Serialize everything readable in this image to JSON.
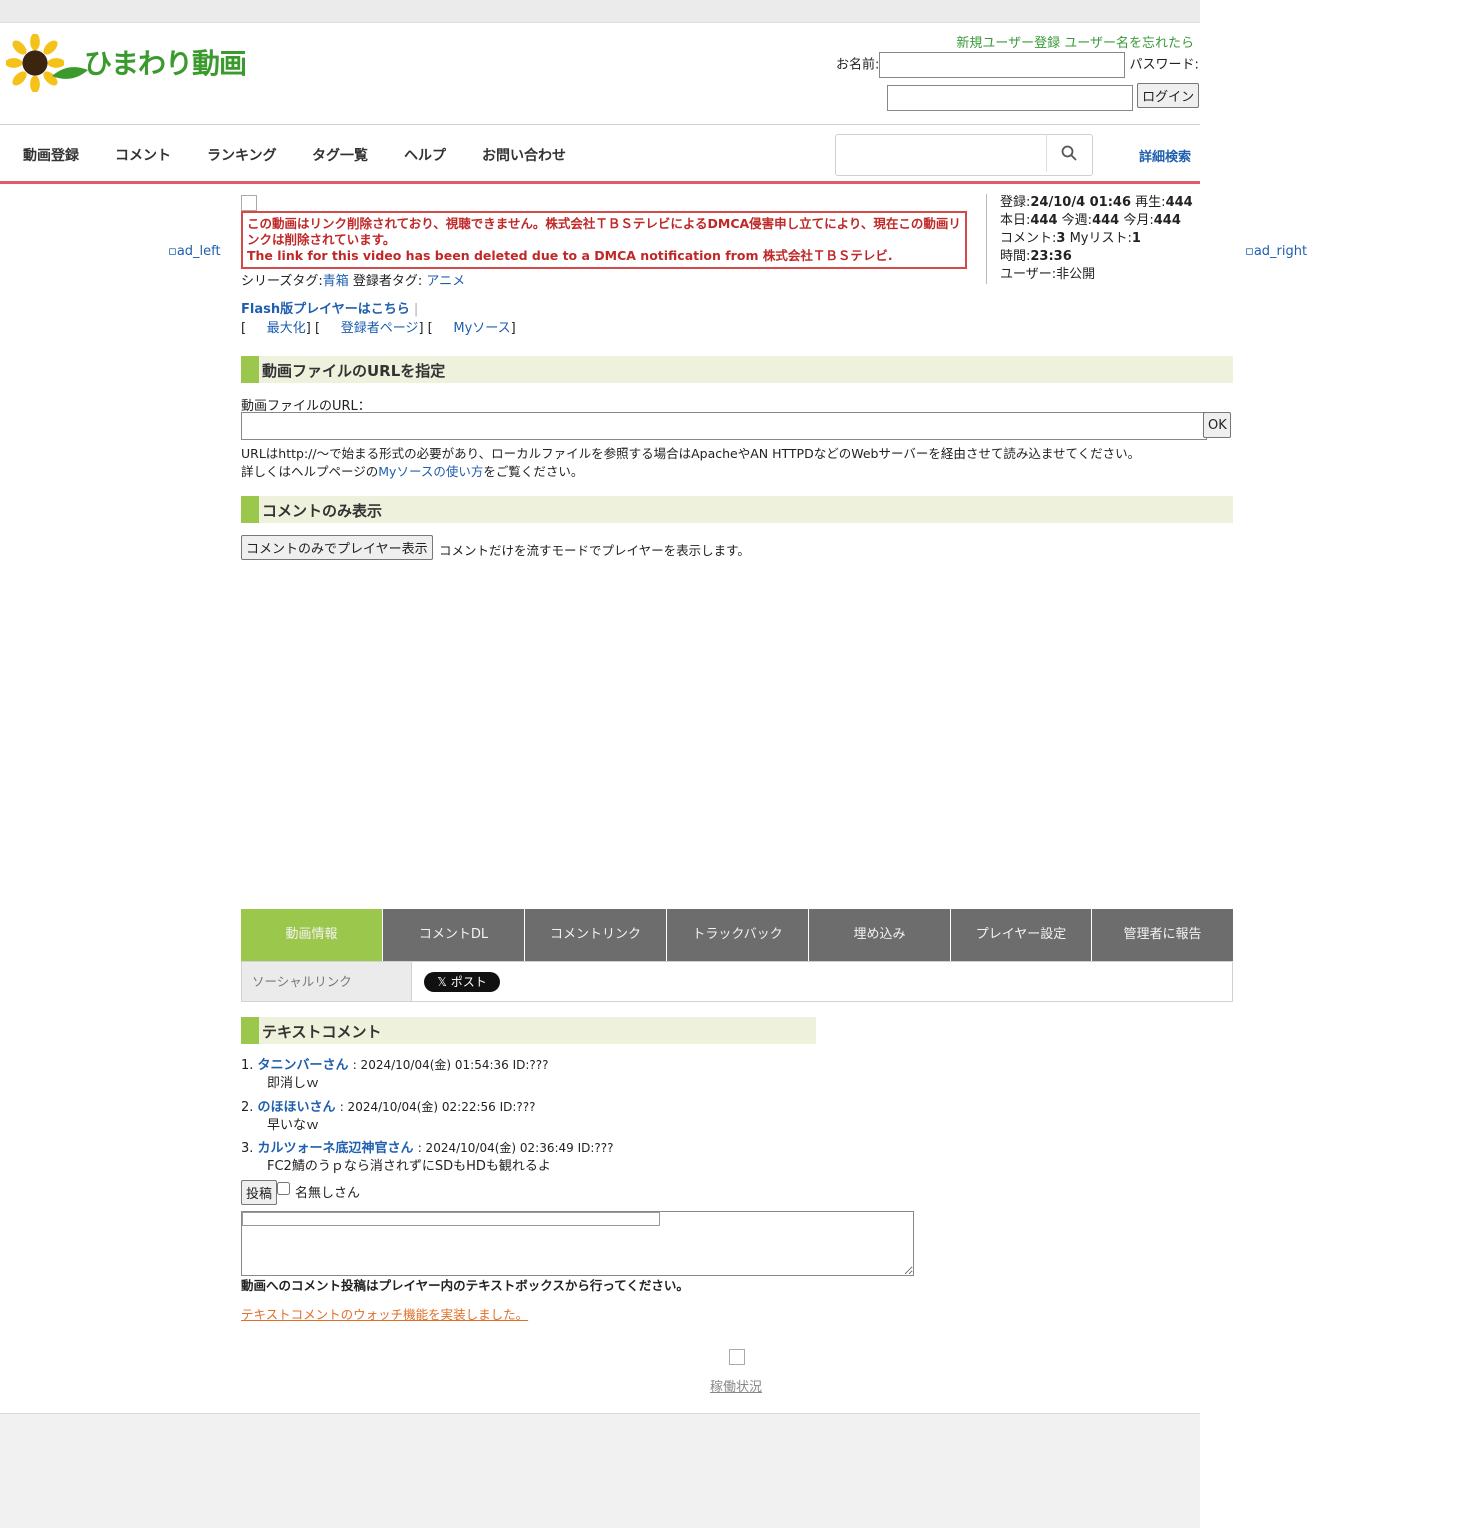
{
  "header": {
    "site_name": "ひまわり動画",
    "register_link": "新規ユーザー登録",
    "forgot_link": "ユーザー名を忘れたら",
    "name_label": "お名前:",
    "password_label": "パスワード:",
    "login_button": "ログイン"
  },
  "nav": {
    "items": [
      "動画登録",
      "コメント",
      "ランキング",
      "タグ一覧",
      "ヘルプ",
      "お問い合わせ"
    ],
    "detail_search": "詳細検索"
  },
  "ads": {
    "left": "ad_left",
    "right": "ad_right"
  },
  "notice": {
    "jp": "この動画はリンク削除されており、視聴できません。株式会社ＴＢＳテレビによるDMCA侵害申し立てにより、現在この動画リンクは削除されています。",
    "en": "The link for this video has been deleted due to a DMCA notification from 株式会社ＴＢＳテレビ."
  },
  "tags": {
    "series_label": "シリーズタグ:",
    "series_value": "青箱",
    "user_label": "登録者タグ:",
    "user_value": "アニメ"
  },
  "links": {
    "flash": "Flash版プレイヤーはこちら",
    "maximize": "最大化",
    "uploader": "登録者ページ",
    "mysource": "Myソース"
  },
  "stats": {
    "registered_label": "登録:",
    "registered": "24/10/4 01:46",
    "plays_label": "再生:",
    "plays": "444",
    "today_label": "本日:",
    "today": "444",
    "week_label": "今週:",
    "week": "444",
    "month_label": "今月:",
    "month": "444",
    "comments_label": "コメント:",
    "comments": "3",
    "mylist_label": "Myリスト:",
    "mylist": "1",
    "duration_label": "時間:",
    "duration": "23:36",
    "user_label": "ユーザー:",
    "user": "非公開"
  },
  "url_section": {
    "heading": "動画ファイルのURLを指定",
    "label": "動画ファイルのURL：",
    "ok": "OK",
    "note1": "URLはhttp://〜で始まる形式の必要があり、ローカルファイルを参照する場合はApacheやAN HTTPDなどのWebサーバーを経由させて読み込ませてください。",
    "note2_pre": "詳しくはヘルプページの",
    "note2_link": "Myソースの使い方",
    "note2_post": "をご覧ください。"
  },
  "comment_only": {
    "heading": "コメントのみ表示",
    "button": "コメントのみでプレイヤー表示",
    "desc": "コメントだけを流すモードでプレイヤーを表示します。"
  },
  "tabs": [
    "動画情報",
    "コメントDL",
    "コメントリンク",
    "トラックバック",
    "埋め込み",
    "プレイヤー設定",
    "管理者に報告"
  ],
  "social": {
    "label": "ソーシャルリンク",
    "post": "𝕏 ポスト"
  },
  "text_comments": {
    "heading": "テキストコメント",
    "items": [
      {
        "no": "1.",
        "name": "タニンバーさん",
        "meta": ": 2024/10/04(金) 01:54:36 ID:???",
        "body": "即消しｗ"
      },
      {
        "no": "2.",
        "name": "のほほいさん",
        "meta": ": 2024/10/04(金) 02:22:56 ID:???",
        "body": "早いなｗ"
      },
      {
        "no": "3.",
        "name": "カルツォーネ底辺神官さん",
        "meta": ": 2024/10/04(金) 02:36:49 ID:???",
        "body": "FC2鯖のうｐなら消されずにSDもHDも観れるよ"
      }
    ],
    "post_button": "投稿",
    "anon_label": "名無しさん",
    "notice": "動画へのコメント投稿はプレイヤー内のテキストボックスから行ってください。",
    "watch_link": "テキストコメントのウォッチ機能を実装しました。"
  },
  "footer": {
    "status_link": "稼働状況"
  }
}
